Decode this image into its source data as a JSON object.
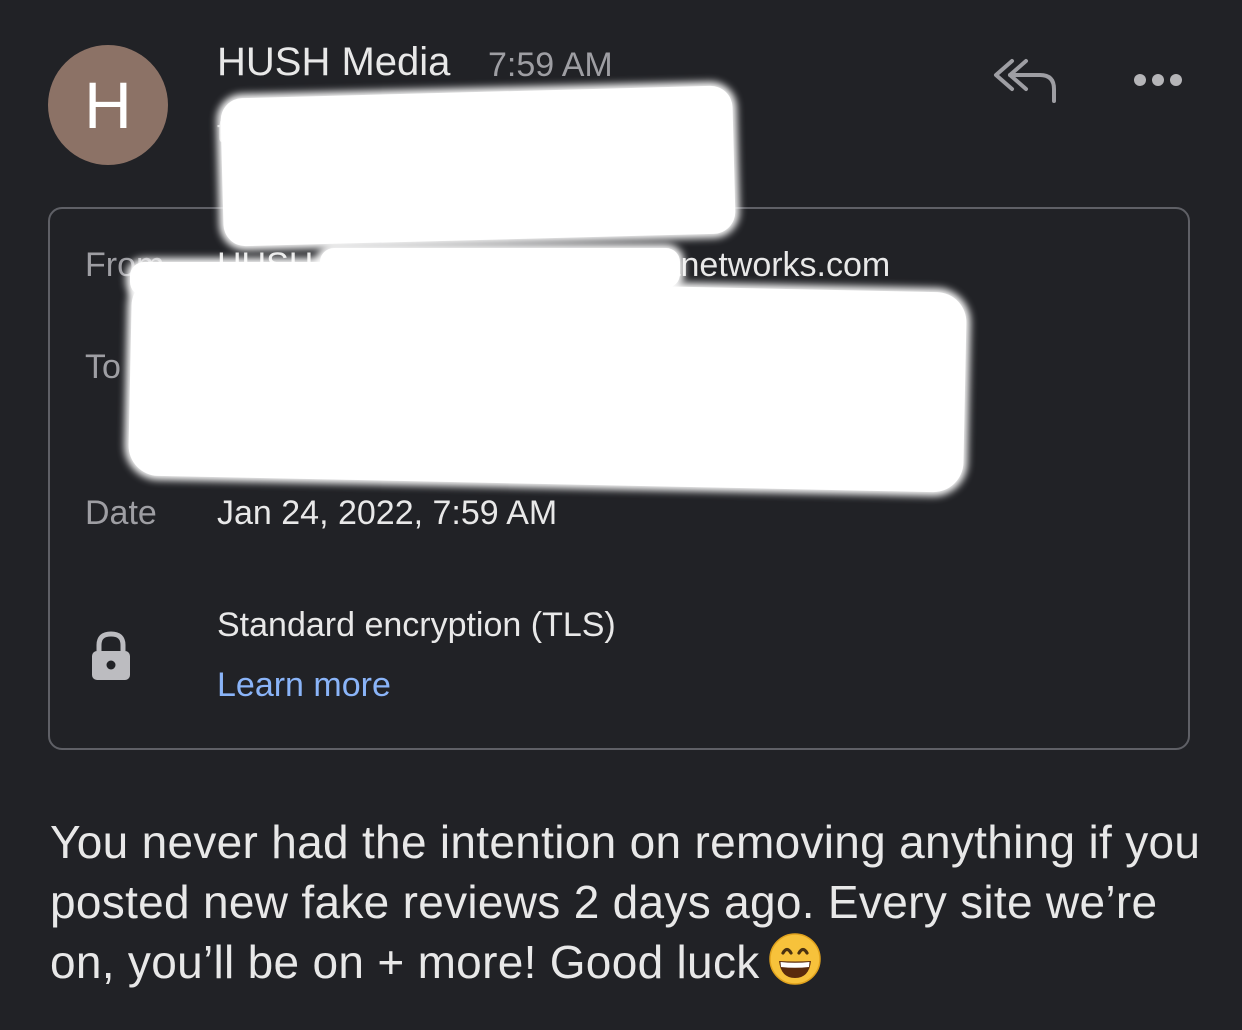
{
  "header": {
    "avatar_letter": "H",
    "sender_name": "HUSH Media",
    "time": "7:59 AM",
    "recipient_summary": "to"
  },
  "actions": {
    "reply_all_icon": "reply-all-icon",
    "more_icon": "more-horizontal-icon"
  },
  "details": {
    "from_label": "From",
    "from_value": "HUSH Media     info@hushmedianetworks.com",
    "to_label": "To",
    "date_label": "Date",
    "date_value": "Jan 24, 2022, 7:59 AM",
    "encryption_icon": "lock-icon",
    "encryption_text": "Standard encryption (TLS)",
    "learn_more": "Learn more"
  },
  "message": {
    "body": "You never had the intention on removing anything if you posted new fake reviews 2 days ago. Every site we’re on, you’ll be on + more! Good luck",
    "emoji": "grinning-face-emoji"
  },
  "colors": {
    "background": "#212226",
    "avatar": "#8c7266",
    "link": "#8ab4f8",
    "muted": "#9e9ea3",
    "border": "#5f6066"
  }
}
